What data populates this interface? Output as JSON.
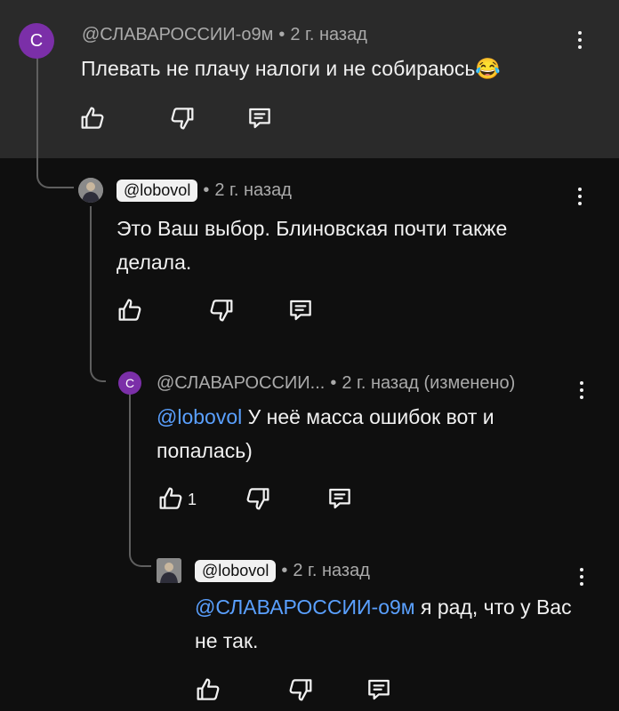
{
  "comments": [
    {
      "avatar_letter": "С",
      "author": "@СЛАВАРОССИИ-о9м",
      "time": "2 г. назад",
      "text": "Плевать не плачу налоги и не собираюсь😂"
    },
    {
      "author": "@lobovol",
      "time": "2 г. назад",
      "text": "Это Ваш выбор. Блиновская почти также делала."
    },
    {
      "avatar_letter": "С",
      "author": "@СЛАВАРОССИИ...",
      "time": "2 г. назад (изменено)",
      "mention": "@lobovol",
      "text": "У неё масса ошибок вот и попалась)",
      "like_count": "1"
    },
    {
      "author": "@lobovol",
      "time": "2 г. назад",
      "mention": "@СЛАВАРОССИИ-о9м",
      "text": "я рад, что у Вас не так."
    }
  ],
  "separator": "•",
  "icons": {
    "like": "thumbs-up-icon",
    "dislike": "thumbs-down-icon",
    "reply": "reply-icon",
    "menu": "more-vert-icon"
  },
  "colors": {
    "background": "#0f0f0f",
    "highlight_panel": "#2a2a2a",
    "avatar_purple": "#7b2fa8",
    "mention_blue": "#5aa0ff",
    "meta_gray": "#aaaaaa"
  }
}
